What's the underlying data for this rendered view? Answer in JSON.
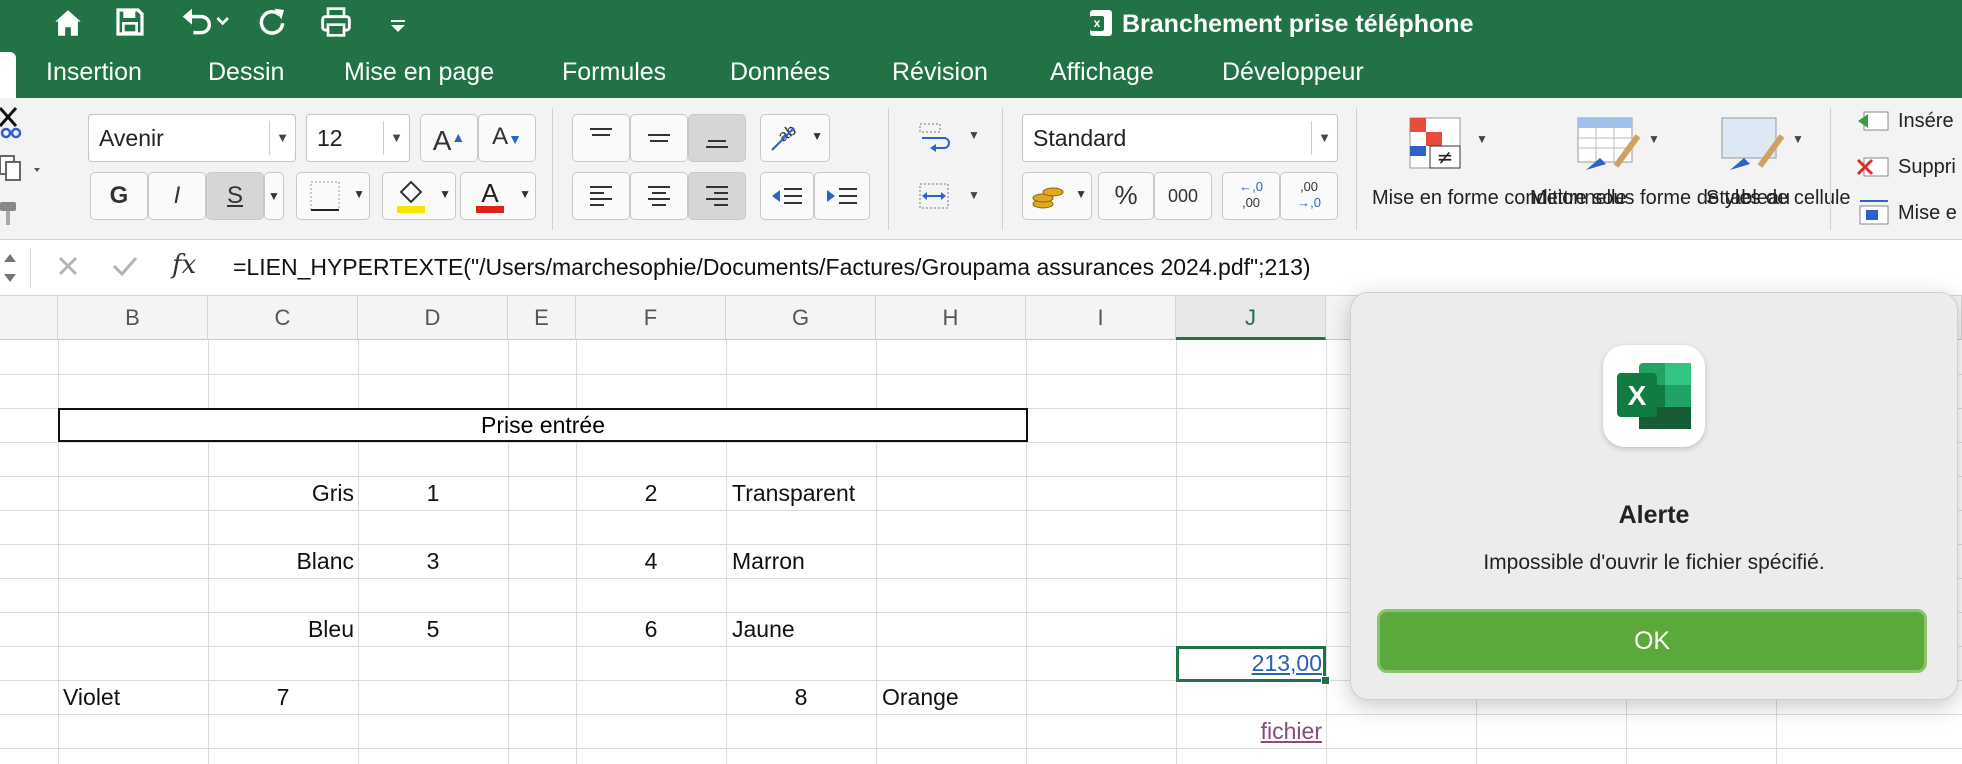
{
  "window": {
    "title": "Branchement prise téléphone",
    "accent_color": "#217346"
  },
  "quick_access": [
    "home-icon",
    "save-icon",
    "undo-icon",
    "redo-icon",
    "print-icon",
    "customize-icon"
  ],
  "tabs": [
    "Insertion",
    "Dessin",
    "Mise en page",
    "Formules",
    "Données",
    "Révision",
    "Affichage",
    "Développeur"
  ],
  "ribbon": {
    "font_name": "Avenir",
    "font_size": "12",
    "bold": "G",
    "italic": "I",
    "strike": "S",
    "number_format": "Standard",
    "percent": "%",
    "thousands": "000",
    "dec_inc_top": "←,0",
    "dec_inc_bottom": ",00",
    "dec_dec_top": ",00",
    "dec_dec_bottom": "→,0",
    "cond_format": "Mise en forme conditionnelle",
    "as_table": "Mettre sous forme de tableau",
    "cell_styles": "Styles de cellule",
    "insert": "Insére",
    "delete": "Suppri",
    "format": "Mise e"
  },
  "formula_bar": {
    "fx": "fx",
    "formula": "=LIEN_HYPERTEXTE(\"/Users/marchesophie/Documents/Factures/Groupama assurances 2024.pdf\";213)"
  },
  "sheet": {
    "columns": [
      "B",
      "C",
      "D",
      "E",
      "F",
      "G",
      "H",
      "I",
      "J"
    ],
    "selected_column": "J",
    "merged_title": "Prise entrée",
    "cells": {
      "c1": "Gris",
      "d1": "1",
      "f1": "2",
      "g1": "Transparent",
      "c2": "Blanc",
      "d2": "3",
      "f2": "4",
      "g2": "Marron",
      "c3": "Bleu",
      "d3": "5",
      "f3": "6",
      "g3": "Jaune",
      "j_link": "213,00",
      "b4": "Violet",
      "c4": "7",
      "g4": "8",
      "h4": "Orange",
      "j_fichier": "fichier"
    }
  },
  "dialog": {
    "title": "Alerte",
    "message": "Impossible d'ouvrir le fichier spécifié.",
    "ok": "OK"
  }
}
